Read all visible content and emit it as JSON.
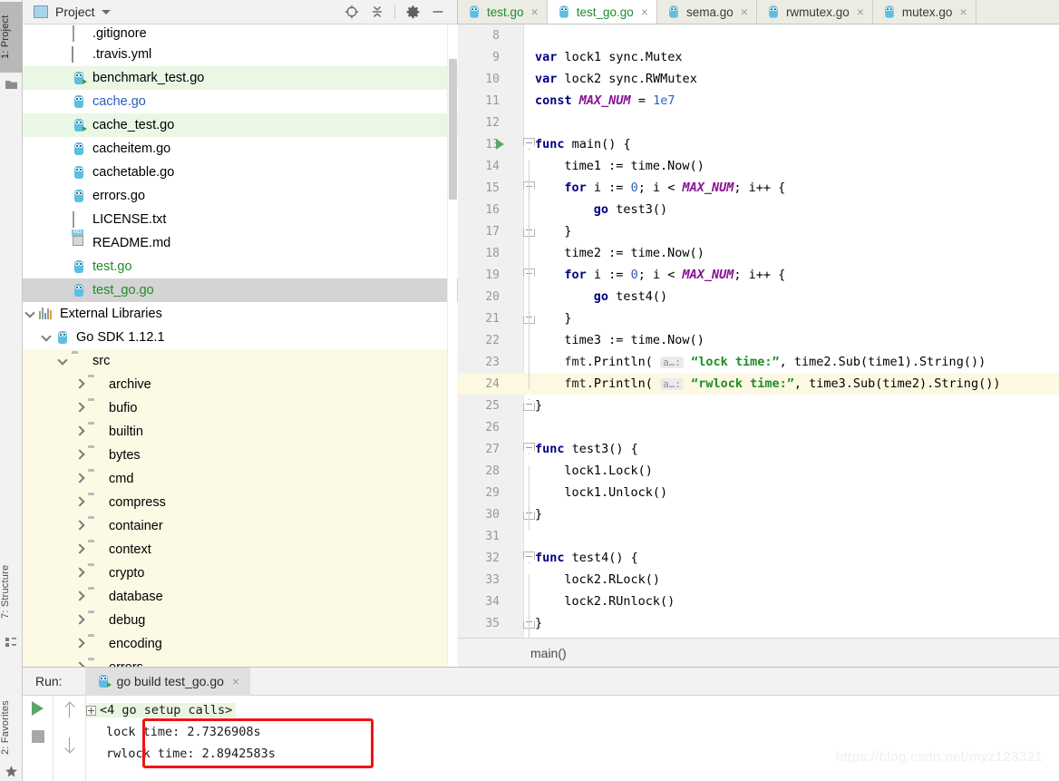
{
  "rail": {
    "top_tool": {
      "label": "1: Project",
      "icon": "folder-icon"
    },
    "bottom_tools": [
      {
        "label": "7: Structure",
        "icon": "structure-icon"
      },
      {
        "label": "2: Favorites",
        "icon": "star-icon"
      }
    ]
  },
  "project_panel": {
    "title": "Project",
    "dropdown_icon": "chevron-down-icon",
    "toolbar": [
      {
        "name": "locate-icon",
        "glyph": "crosshair"
      },
      {
        "name": "collapse-all-icon",
        "glyph": "collapse"
      },
      {
        "name": "settings-gear-icon",
        "glyph": "gear"
      },
      {
        "name": "hide-panel-icon",
        "glyph": "minus"
      }
    ],
    "tree": [
      {
        "label": ".gitignore",
        "icon": "txt-file-icon",
        "indent": 2,
        "twisty": "none",
        "color": "black",
        "row_bg": "white",
        "clipped": true
      },
      {
        "label": ".travis.yml",
        "icon": "yml-file-icon",
        "indent": 2,
        "twisty": "none",
        "color": "black",
        "row_bg": "white"
      },
      {
        "label": "benchmark_test.go",
        "icon": "go-test-file-icon",
        "indent": 2,
        "twisty": "none",
        "color": "black",
        "row_bg": "green"
      },
      {
        "label": "cache.go",
        "icon": "go-file-icon",
        "indent": 2,
        "twisty": "none",
        "color": "blue",
        "row_bg": "white"
      },
      {
        "label": "cache_test.go",
        "icon": "go-test-file-icon",
        "indent": 2,
        "twisty": "none",
        "color": "black",
        "row_bg": "green"
      },
      {
        "label": "cacheitem.go",
        "icon": "go-file-icon",
        "indent": 2,
        "twisty": "none",
        "color": "black",
        "row_bg": "white"
      },
      {
        "label": "cachetable.go",
        "icon": "go-file-icon",
        "indent": 2,
        "twisty": "none",
        "color": "black",
        "row_bg": "white"
      },
      {
        "label": "errors.go",
        "icon": "go-file-icon",
        "indent": 2,
        "twisty": "none",
        "color": "black",
        "row_bg": "white"
      },
      {
        "label": "LICENSE.txt",
        "icon": "txt-file-icon",
        "indent": 2,
        "twisty": "none",
        "color": "black",
        "row_bg": "white"
      },
      {
        "label": "README.md",
        "icon": "md-file-icon",
        "indent": 2,
        "twisty": "none",
        "color": "black",
        "row_bg": "white"
      },
      {
        "label": "test.go",
        "icon": "go-file-icon",
        "indent": 2,
        "twisty": "none",
        "color": "green",
        "row_bg": "white"
      },
      {
        "label": "test_go.go",
        "icon": "go-file-icon",
        "indent": 2,
        "twisty": "none",
        "color": "green",
        "row_bg": "gray"
      },
      {
        "label": "External Libraries",
        "icon": "library-icon",
        "indent": 0,
        "twisty": "down",
        "color": "black",
        "row_bg": "white"
      },
      {
        "label": "Go SDK 1.12.1",
        "icon": "go-file-icon",
        "indent": 1,
        "twisty": "down",
        "color": "black",
        "row_bg": "white"
      },
      {
        "label": "src",
        "icon": "folder-icon",
        "indent": 2,
        "twisty": "down",
        "color": "black",
        "row_bg": "yellow"
      },
      {
        "label": "archive",
        "icon": "folder-icon",
        "indent": 3,
        "twisty": "right",
        "color": "black",
        "row_bg": "yellow"
      },
      {
        "label": "bufio",
        "icon": "folder-icon",
        "indent": 3,
        "twisty": "right",
        "color": "black",
        "row_bg": "yellow"
      },
      {
        "label": "builtin",
        "icon": "folder-icon",
        "indent": 3,
        "twisty": "right",
        "color": "black",
        "row_bg": "yellow"
      },
      {
        "label": "bytes",
        "icon": "folder-icon",
        "indent": 3,
        "twisty": "right",
        "color": "black",
        "row_bg": "yellow"
      },
      {
        "label": "cmd",
        "icon": "folder-icon",
        "indent": 3,
        "twisty": "right",
        "color": "black",
        "row_bg": "yellow"
      },
      {
        "label": "compress",
        "icon": "folder-icon",
        "indent": 3,
        "twisty": "right",
        "color": "black",
        "row_bg": "yellow"
      },
      {
        "label": "container",
        "icon": "folder-icon",
        "indent": 3,
        "twisty": "right",
        "color": "black",
        "row_bg": "yellow"
      },
      {
        "label": "context",
        "icon": "folder-icon",
        "indent": 3,
        "twisty": "right",
        "color": "black",
        "row_bg": "yellow"
      },
      {
        "label": "crypto",
        "icon": "folder-icon",
        "indent": 3,
        "twisty": "right",
        "color": "black",
        "row_bg": "yellow"
      },
      {
        "label": "database",
        "icon": "folder-icon",
        "indent": 3,
        "twisty": "right",
        "color": "black",
        "row_bg": "yellow"
      },
      {
        "label": "debug",
        "icon": "folder-icon",
        "indent": 3,
        "twisty": "right",
        "color": "black",
        "row_bg": "yellow"
      },
      {
        "label": "encoding",
        "icon": "folder-icon",
        "indent": 3,
        "twisty": "right",
        "color": "black",
        "row_bg": "yellow"
      },
      {
        "label": "errors",
        "icon": "folder-icon",
        "indent": 3,
        "twisty": "right",
        "color": "black",
        "row_bg": "yellow",
        "clipped": true
      }
    ]
  },
  "editor_tabs": [
    {
      "label": "test.go",
      "color": "green",
      "active": false,
      "close_icon": "×"
    },
    {
      "label": "test_go.go",
      "color": "green",
      "active": true,
      "close_icon": "×"
    },
    {
      "label": "sema.go",
      "color": "dark",
      "active": false,
      "close_icon": "×"
    },
    {
      "label": "rwmutex.go",
      "color": "dark",
      "active": false,
      "close_icon": "×"
    },
    {
      "label": "mutex.go",
      "color": "dark",
      "active": false,
      "close_icon": "×"
    }
  ],
  "editor": {
    "breadcrumb": "main()",
    "lines": [
      {
        "n": "8",
        "text": ""
      },
      {
        "n": "9",
        "text": "var lock1 sync.Mutex"
      },
      {
        "n": "10",
        "text": "var lock2 sync.RWMutex"
      },
      {
        "n": "11",
        "text": "const MAX_NUM = 1e7"
      },
      {
        "n": "12",
        "text": ""
      },
      {
        "n": "13",
        "text": "func main() {"
      },
      {
        "n": "14",
        "text": "    time1 := time.Now()"
      },
      {
        "n": "15",
        "text": "    for i := 0; i < MAX_NUM; i++ {"
      },
      {
        "n": "16",
        "text": "        go test3()"
      },
      {
        "n": "17",
        "text": "    }"
      },
      {
        "n": "18",
        "text": "    time2 := time.Now()"
      },
      {
        "n": "19",
        "text": "    for i := 0; i < MAX_NUM; i++ {"
      },
      {
        "n": "20",
        "text": "        go test4()"
      },
      {
        "n": "21",
        "text": "    }"
      },
      {
        "n": "22",
        "text": "    time3 := time.Now()"
      },
      {
        "n": "23",
        "text": "    fmt.Println( a…: \"lock time:\", time2.Sub(time1).String())"
      },
      {
        "n": "24",
        "text": "    fmt.Println( a…: \"rwlock time:\", time3.Sub(time2).String())"
      },
      {
        "n": "25",
        "text": "}"
      },
      {
        "n": "26",
        "text": ""
      },
      {
        "n": "27",
        "text": "func test3() {"
      },
      {
        "n": "28",
        "text": "    lock1.Lock()"
      },
      {
        "n": "29",
        "text": "    lock1.Unlock()"
      },
      {
        "n": "30",
        "text": "}"
      },
      {
        "n": "31",
        "text": ""
      },
      {
        "n": "32",
        "text": "func test4() {"
      },
      {
        "n": "33",
        "text": "    lock2.RLock()"
      },
      {
        "n": "34",
        "text": "    lock2.RUnlock()"
      },
      {
        "n": "35",
        "text": "}"
      }
    ],
    "inlay_hint": "a…:",
    "tokens": {
      "kw_var": "var",
      "kw_const": "const",
      "kw_func": "func",
      "kw_for": "for",
      "kw_go": "go",
      "const_name": "MAX_NUM",
      "str_lock": "\"lock time:\"",
      "str_rwlock": "\"rwlock time:\""
    }
  },
  "run_window": {
    "label": "Run:",
    "tab_title": "go build test_go.go",
    "tab_close_icon": "×",
    "toolbar": [
      {
        "name": "rerun-button",
        "glyph": "play"
      },
      {
        "name": "stop-button",
        "glyph": "stop"
      },
      {
        "name": "prev-occurrence-button",
        "glyph": "arrow-up"
      },
      {
        "name": "next-occurrence-button",
        "glyph": "arrow-down"
      }
    ],
    "console": {
      "setup_line": "<4 go setup calls>",
      "expand_icon": "plus-box-icon",
      "output_lines": [
        "lock time: 2.7326908s",
        "rwlock time: 2.8942583s"
      ]
    },
    "annotation": {
      "name": "red-highlight-box",
      "color": "#f01414"
    }
  },
  "watermark": "https://blog.csdn.net/myz123321",
  "colors": {
    "keyword": "#000080",
    "string": "#1f8c2a",
    "constant": "#871094",
    "number": "#2b5fbe",
    "run_green": "#59a869",
    "highlight_line": "#fdf8e2",
    "tree_green_row": "#eaf7e4",
    "tree_yellow_row": "#fcfae4",
    "annotation_red": "#f01414"
  }
}
